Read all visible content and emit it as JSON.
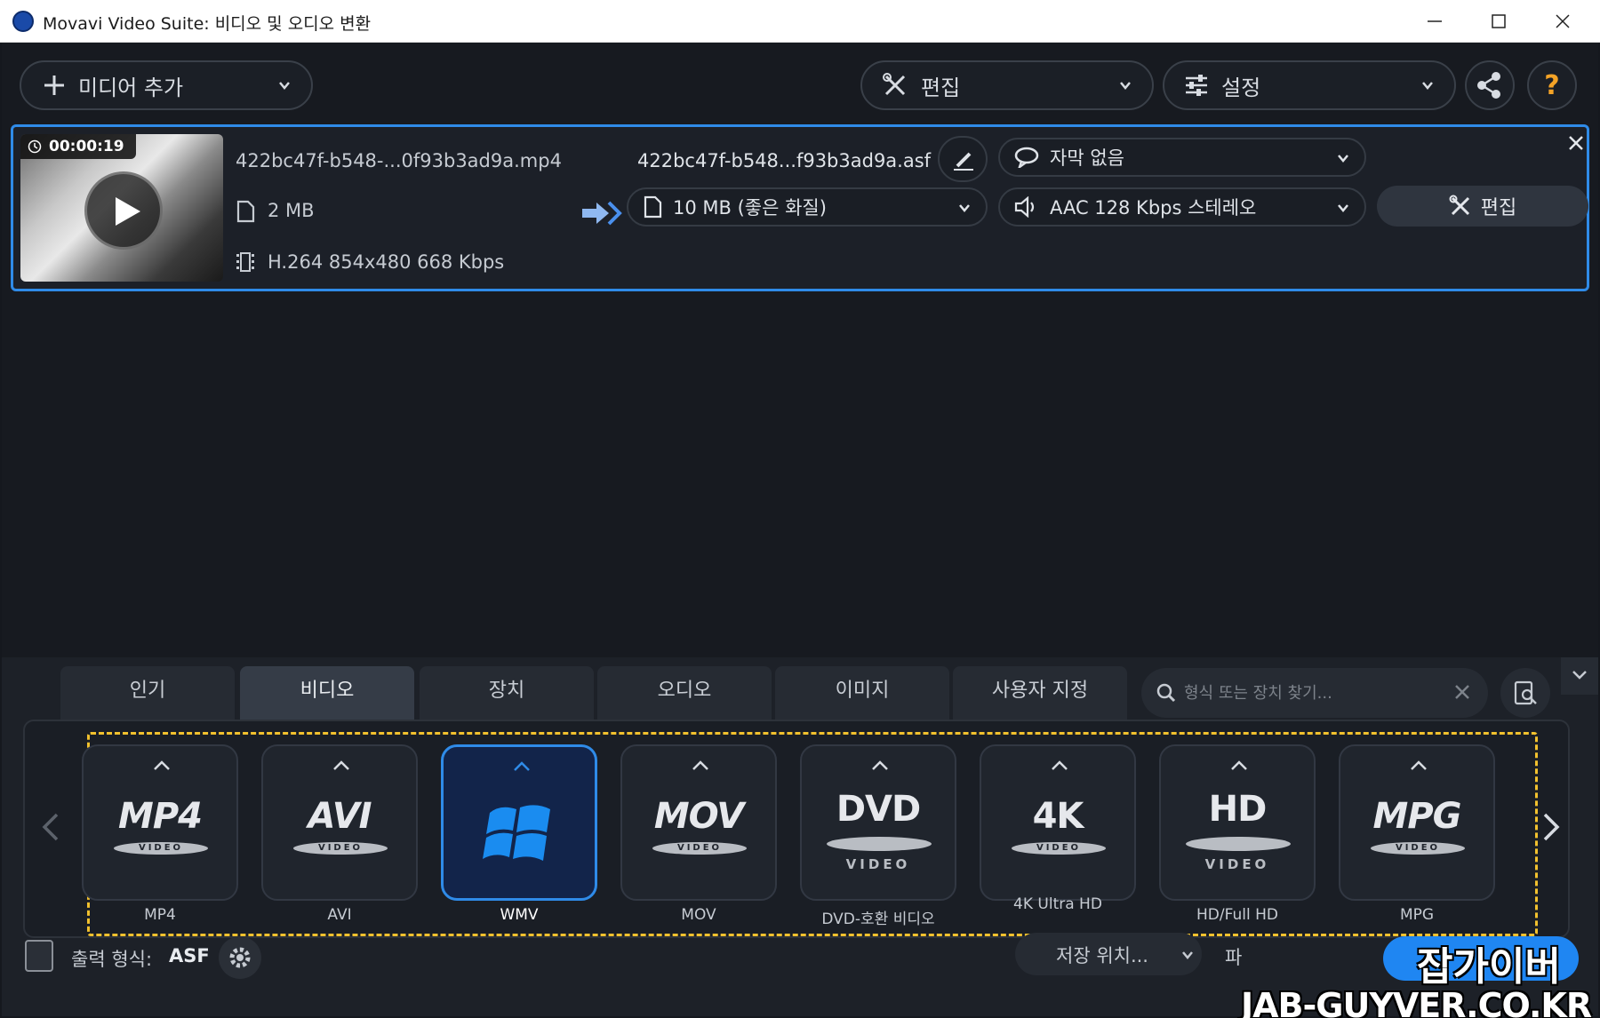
{
  "window": {
    "title": "Movavi Video Suite: 비디오 및 오디오 변환"
  },
  "toolbar": {
    "add_media": "미디어 추가",
    "edit": "편집",
    "settings": "설정",
    "help": "?"
  },
  "file": {
    "duration": "00:00:19",
    "source_name": "422bc47f-b548-...0f93b3ad9a.mp4",
    "source_size": "2 MB",
    "source_codec": "H.264 854x480 668 Kbps",
    "output_name": "422bc47f-b548...f93b3ad9a.asf",
    "subtitles": "자막 없음",
    "quality": "10 MB (좋은 화질)",
    "audio": "AAC 128 Kbps 스테레오",
    "edit_label": "편집"
  },
  "tabs": [
    {
      "label": "인기",
      "active": false
    },
    {
      "label": "비디오",
      "active": true
    },
    {
      "label": "장치",
      "active": false
    },
    {
      "label": "오디오",
      "active": false
    },
    {
      "label": "이미지",
      "active": false
    },
    {
      "label": "사용자 지정",
      "active": false
    }
  ],
  "search": {
    "placeholder": "형식 또는 장치 찾기..."
  },
  "formats": [
    {
      "logo": "MP4",
      "sub": "VIDEO",
      "label": "MP4"
    },
    {
      "logo": "AVI",
      "sub": "VIDEO",
      "label": "AVI"
    },
    {
      "logo": "",
      "sub": "",
      "label": "WMV",
      "selected": true
    },
    {
      "logo": "MOV",
      "sub": "VIDEO",
      "label": "MOV"
    },
    {
      "logo": "DVD",
      "sub": "VIDEO",
      "label": "DVD-호환 비디오"
    },
    {
      "logo": "4K",
      "sub": "VIDEO",
      "label": "4K Ultra HD"
    },
    {
      "logo": "HD",
      "sub": "VIDEO",
      "label": "HD/Full HD"
    },
    {
      "logo": "MPG",
      "sub": "VIDEO",
      "label": "MPG"
    }
  ],
  "footer": {
    "output_format_label": "출력 형식:",
    "output_format_value": "ASF",
    "save_location": "저장 위치...",
    "merge_files": "파"
  },
  "watermark": {
    "line1": "잡가이버",
    "line2": "JAB-GUYVER.CO.KR"
  },
  "colors": {
    "accent": "#2f8be8",
    "highlight_dash": "#f2c12e",
    "help": "#f4a326",
    "background": "#171a20"
  }
}
